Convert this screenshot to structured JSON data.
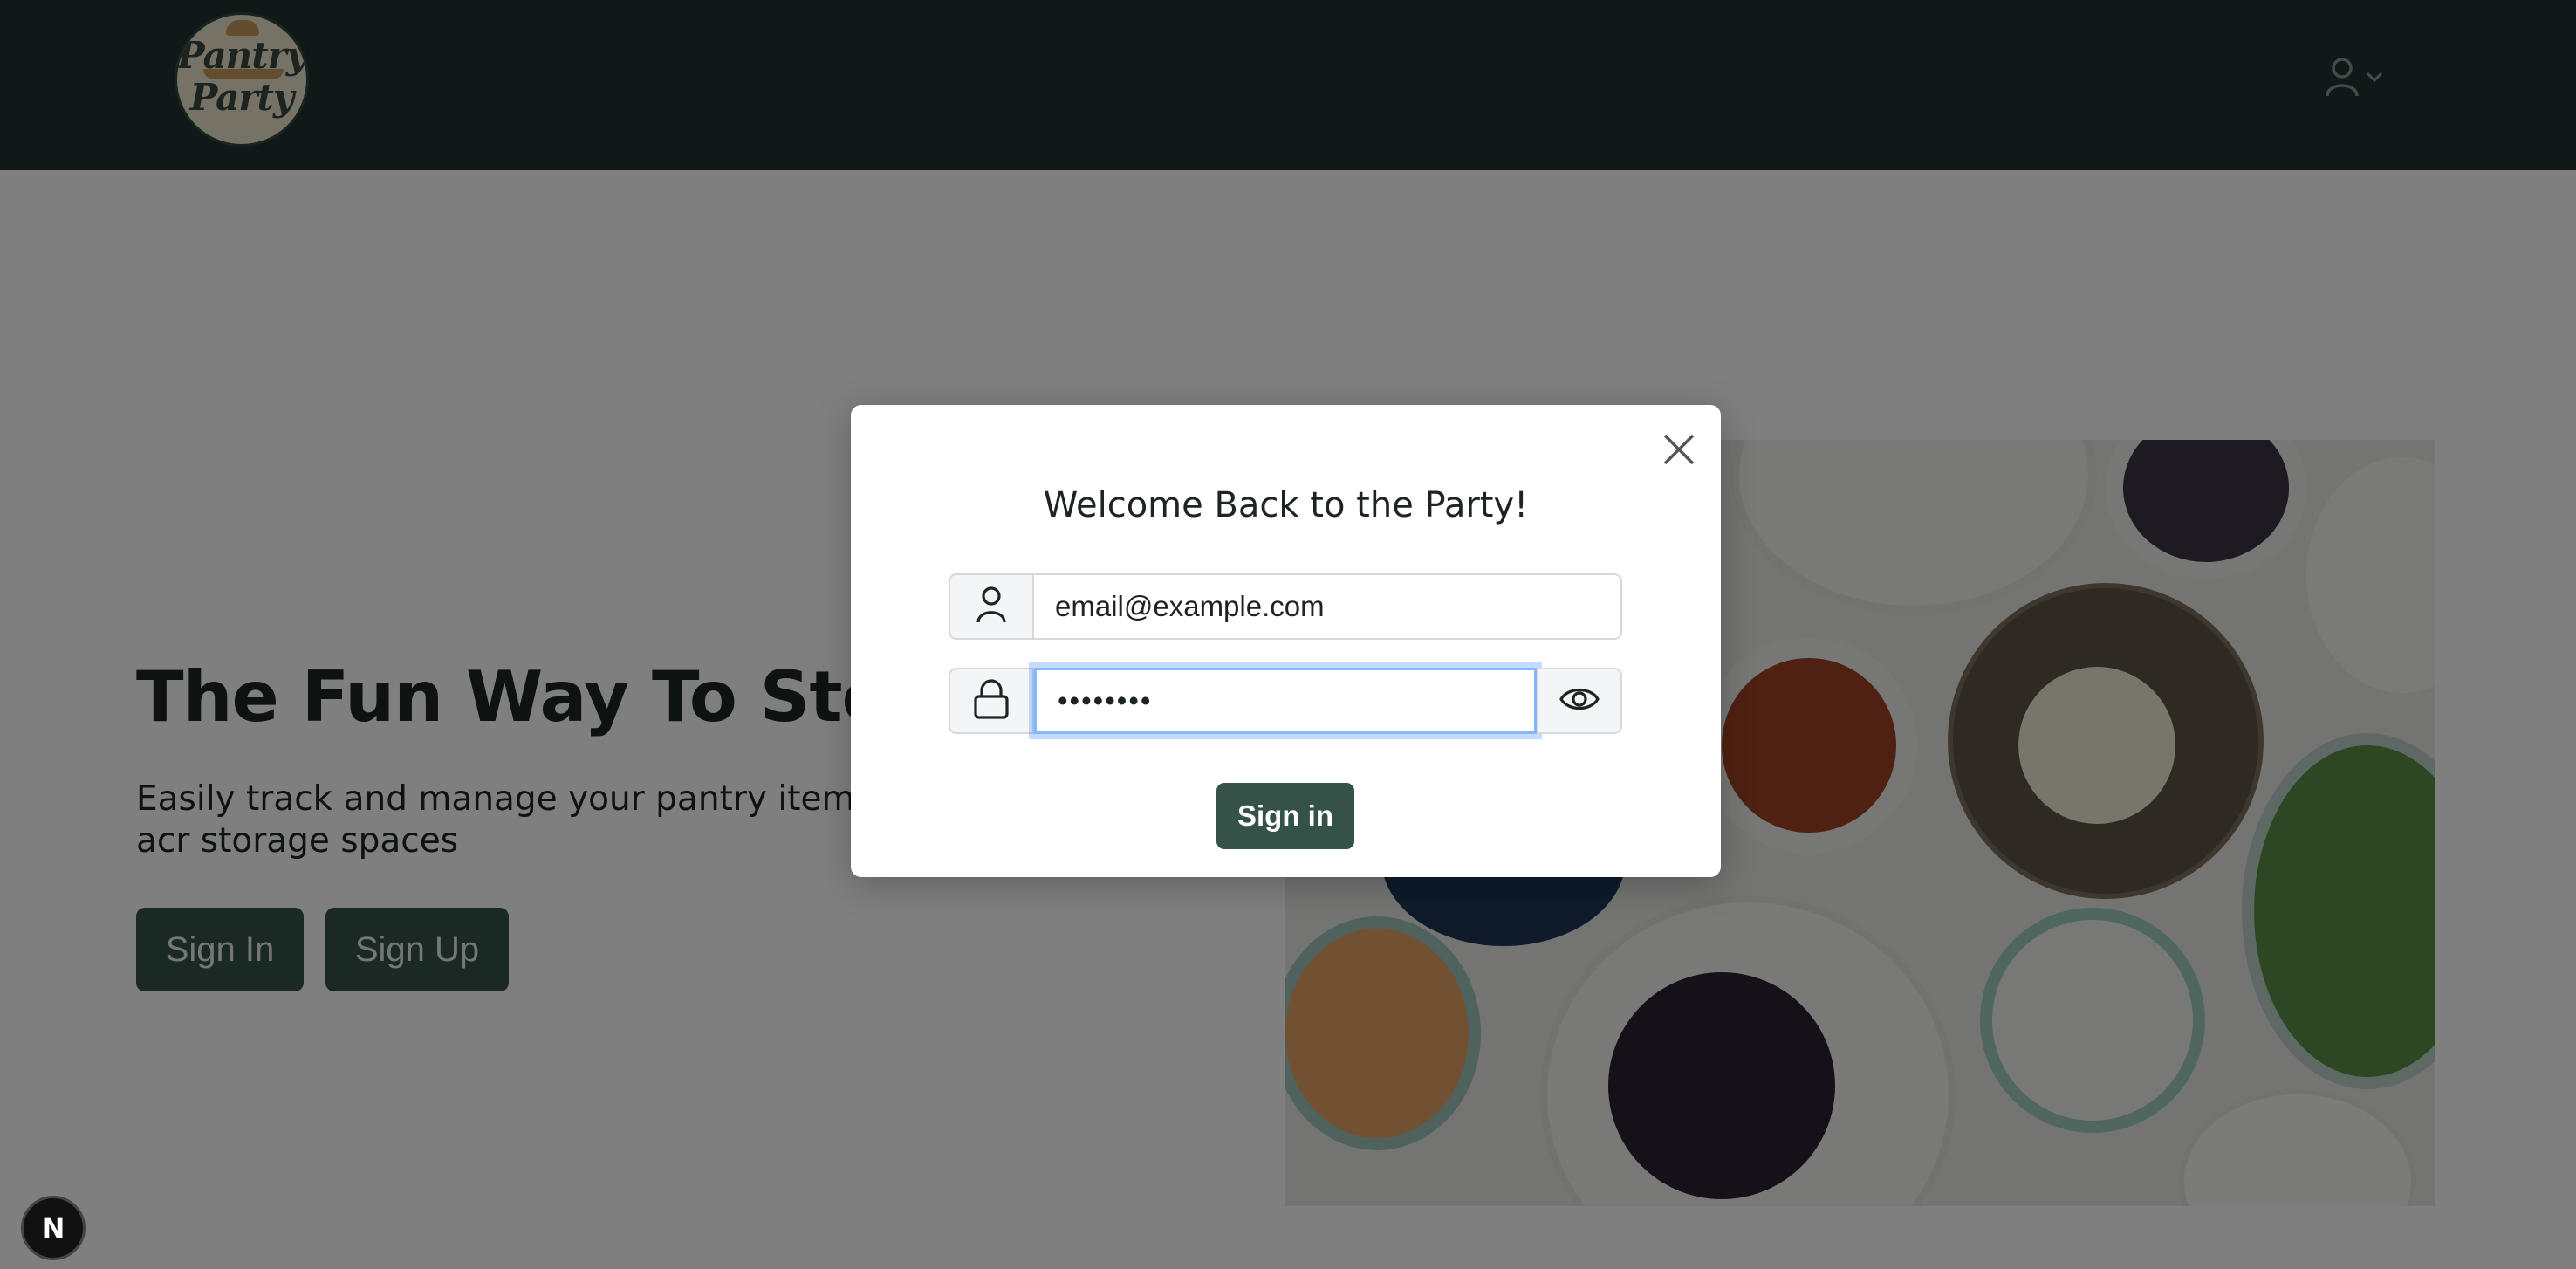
{
  "brand": {
    "logo_line1": "Pantry",
    "logo_line2": "Party"
  },
  "navbar": {
    "user_icon": "user-icon",
    "dropdown_icon": "chevron-down-icon"
  },
  "hero": {
    "title": "The Fun Way To Stock Y",
    "subtitle": "Easily track and manage your pantry items acr storage spaces",
    "signin_label": "Sign In",
    "signup_label": "Sign Up"
  },
  "modal": {
    "title": "Welcome Back to the Party!",
    "email_value": "email@example.com",
    "password_value": "••••••••",
    "submit_label": "Sign in",
    "close_icon": "close-icon",
    "password_toggle_icon": "eye-icon"
  },
  "dev_badge": {
    "label": "N"
  },
  "colors": {
    "navbar_bg": "#233230",
    "brand_green": "#355249",
    "overlay": "rgba(0,0,0,0.5)",
    "focus_ring": "#86b7fe"
  }
}
